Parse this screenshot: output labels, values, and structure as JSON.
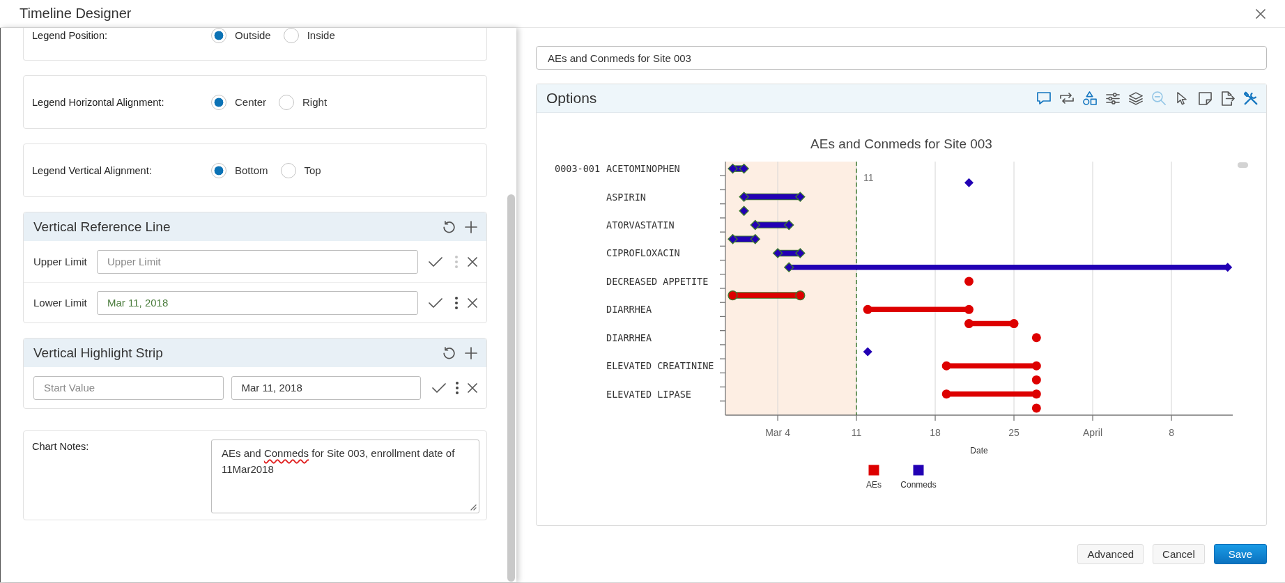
{
  "window": {
    "title": "Timeline Designer"
  },
  "settings": {
    "radio_groups": [
      {
        "label": "Legend Position:",
        "options": [
          {
            "label": "Outside",
            "selected": true
          },
          {
            "label": "Inside",
            "selected": false
          }
        ]
      },
      {
        "label": "Legend Horizontal Alignment:",
        "options": [
          {
            "label": "Center",
            "selected": true
          },
          {
            "label": "Right",
            "selected": false
          }
        ]
      },
      {
        "label": "Legend Vertical Alignment:",
        "options": [
          {
            "label": "Bottom",
            "selected": true
          },
          {
            "label": "Top",
            "selected": false
          }
        ]
      }
    ],
    "reference_line": {
      "title": "Vertical Reference Line",
      "rows": [
        {
          "label": "Upper Limit",
          "placeholder": "Upper Limit",
          "menu_disabled": true
        },
        {
          "label": "Lower Limit",
          "value": "Mar 11, 2018",
          "color": "#4a7c3c",
          "menu_disabled": false
        }
      ]
    },
    "highlight_strip": {
      "title": "Vertical Highlight Strip",
      "fields": [
        {
          "placeholder": "Start Value"
        },
        {
          "value": "Mar 11, 2018"
        }
      ]
    },
    "chart_notes": {
      "label": "Chart Notes:",
      "value_parts": [
        {
          "text": "AEs and ",
          "misspelled": false
        },
        {
          "text": "Conmeds",
          "misspelled": true
        },
        {
          "text": " for Site 003, enrollment date of 11Mar2018",
          "misspelled": false
        }
      ]
    }
  },
  "chart_title_field": {
    "value": "AEs and Conmeds for Site 003"
  },
  "options": {
    "title": "Options",
    "toolbar": [
      {
        "kind": "comment",
        "active": true,
        "disabled": false
      },
      {
        "kind": "swap",
        "active": false,
        "disabled": false
      },
      {
        "kind": "shapes",
        "active": true,
        "disabled": false
      },
      {
        "kind": "sliders",
        "active": false,
        "disabled": false
      },
      {
        "kind": "layers",
        "active": false,
        "disabled": false
      },
      {
        "kind": "zoomout",
        "active": false,
        "disabled": true
      },
      {
        "kind": "cursor",
        "active": false,
        "disabled": false
      },
      {
        "kind": "note",
        "active": false,
        "disabled": false
      },
      {
        "kind": "export",
        "active": false,
        "disabled": false
      },
      {
        "kind": "tools",
        "active": true,
        "disabled": false
      }
    ],
    "timeline": {
      "title": "AEs and Conmeds for Site 003",
      "subject_id": "0003-001",
      "row_labels": [
        "ACETOMINOPHEN",
        "ASPIRIN",
        "ATORVASTATIN",
        "CIPROFLOXACIN",
        "DECREASED APPETITE",
        "DIARRHEA",
        "DIARRHEA",
        "ELEVATED CREATININE",
        "ELEVATED LIPASE"
      ],
      "x_tick_labels": [
        "Mar 4",
        "11",
        "18",
        "25",
        "April",
        "8"
      ],
      "x_axis_title": "Date",
      "reference_label": "11",
      "legend": [
        {
          "name": "AEs",
          "color": "#dd0000",
          "kind": "circle"
        },
        {
          "name": "Conmeds",
          "color": "#2200b4",
          "kind": "diamond"
        }
      ]
    }
  },
  "buttons": [
    {
      "label": "Advanced",
      "kind": "secondary"
    },
    {
      "label": "Cancel",
      "kind": "secondary"
    },
    {
      "label": "Save",
      "kind": "primary"
    }
  ]
}
